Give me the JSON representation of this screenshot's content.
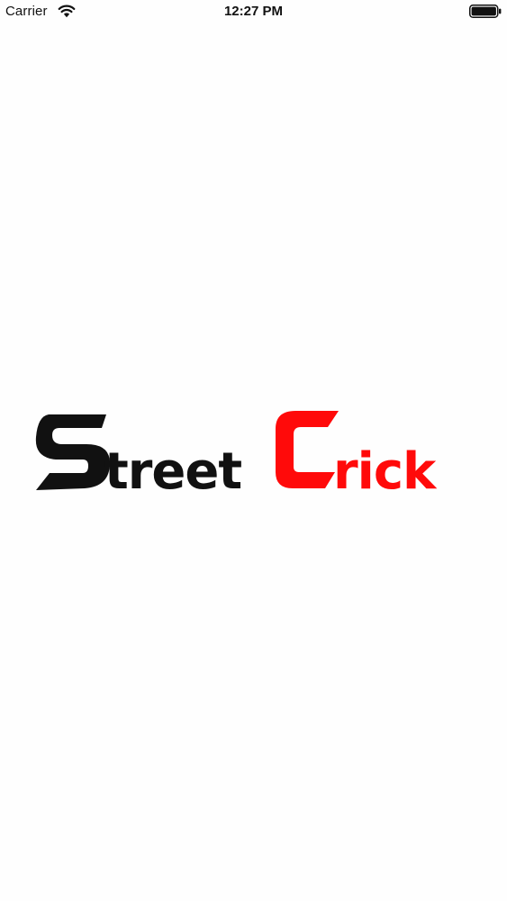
{
  "status_bar": {
    "carrier": "Carrier",
    "time": "12:27 PM",
    "wifi_icon": "wifi-icon",
    "battery_icon": "battery-icon"
  },
  "splash": {
    "logo_part_1": "Street",
    "logo_part_2": "Crick",
    "colors": {
      "part_1": "#111111",
      "part_2": "#ff0a0a",
      "background": "#fefefe"
    }
  }
}
